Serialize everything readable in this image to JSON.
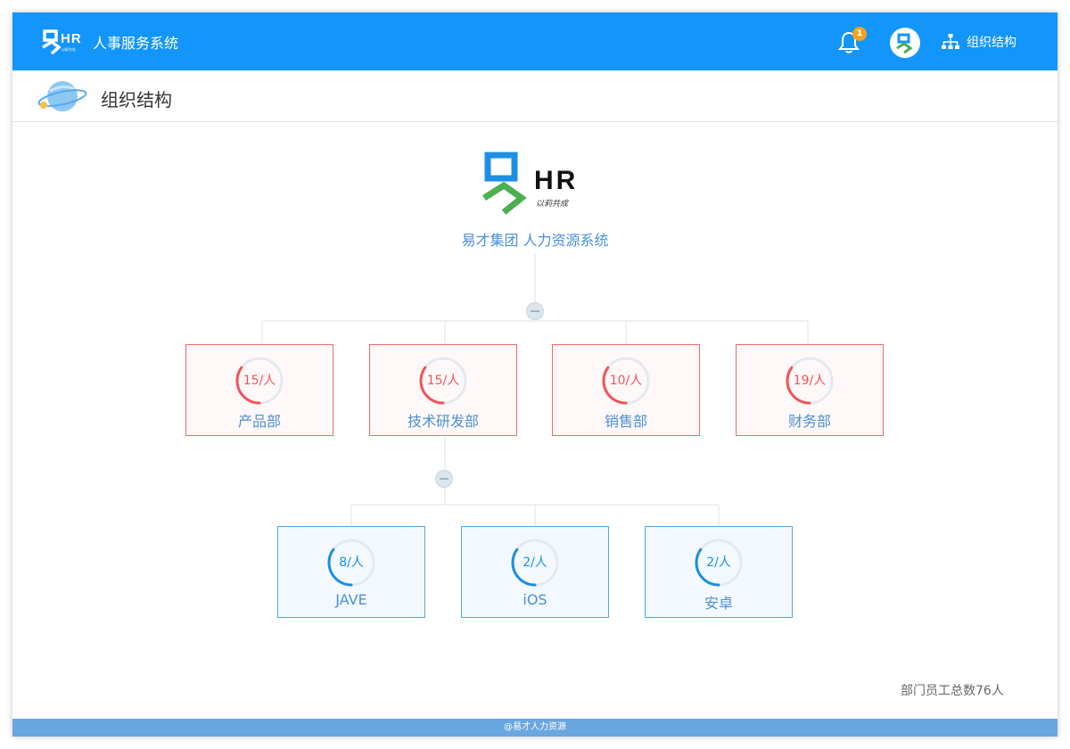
{
  "app": {
    "brand_hr": "HR",
    "brand_sub": "以职为先",
    "title": "人事服务系统",
    "notification_count": "1",
    "org_link_label": "组织结构",
    "accent_color": "#1296fb"
  },
  "page": {
    "title": "组织结构"
  },
  "org": {
    "logo_hr": "HR",
    "logo_slogan": "以莉共成",
    "company": "易才集团 人力资源系统",
    "departments": [
      {
        "count": "15/人",
        "name": "产品部",
        "fill": 0.35
      },
      {
        "count": "15/人",
        "name": "技术研发部",
        "fill": 0.35
      },
      {
        "count": "10/人",
        "name": "销售部",
        "fill": 0.35
      },
      {
        "count": "19/人",
        "name": "财务部",
        "fill": 0.35
      }
    ],
    "sub_departments": [
      {
        "count": "8/人",
        "name": "JAVE",
        "fill": 0.35
      },
      {
        "count": "2/人",
        "name": "iOS",
        "fill": 0.35
      },
      {
        "count": "2/人",
        "name": "安卓",
        "fill": 0.35
      }
    ],
    "total_label": "部门员工总数76人"
  },
  "footer": {
    "text": "@易才人力资源"
  }
}
